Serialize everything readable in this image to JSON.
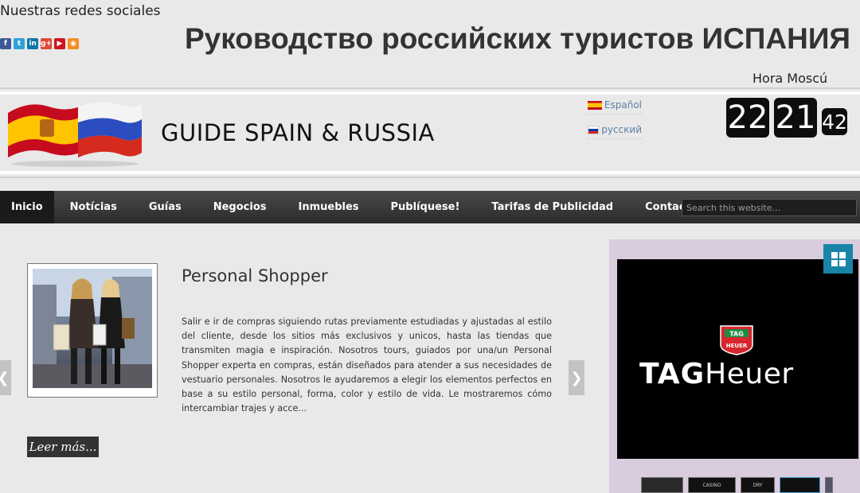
{
  "header": {
    "social_label": "Nuestras redes sociales",
    "site_title": "Руководство российских туристов ИСПАНИЯ",
    "moscow_time_label": "Hora Moscú"
  },
  "social_icons": [
    {
      "name": "facebook-icon",
      "glyph": "f",
      "color": "#3b5998"
    },
    {
      "name": "twitter-icon",
      "glyph": "t",
      "color": "#2fa2d8"
    },
    {
      "name": "linkedin-icon",
      "glyph": "in",
      "color": "#0e76a8"
    },
    {
      "name": "googleplus-icon",
      "glyph": "g+",
      "color": "#dd4b39"
    },
    {
      "name": "youtube-icon",
      "glyph": "▶",
      "color": "#cc181e"
    },
    {
      "name": "rss-icon",
      "glyph": "◉",
      "color": "#f58d25"
    }
  ],
  "brand": {
    "name": "GUIDE SPAIN & RUSSIA"
  },
  "languages": {
    "es": "Español",
    "ru": "русский"
  },
  "clock": {
    "hours": "22",
    "minutes": "21",
    "seconds": "42"
  },
  "nav": {
    "items": [
      "Inicio",
      "Notícias",
      "Guías",
      "Negocios",
      "Inmuebles",
      "Publíquese!",
      "Tarifas de Publicidad",
      "Contacto"
    ],
    "active_index": 0,
    "search_placeholder": "Search this website…"
  },
  "article": {
    "title": "Personal Shopper",
    "body": "Salir e ir de compras siguiendo rutas previamente estudiadas y ajustadas al estilo del cliente, desde los sitios más exclusivos y unicos, hasta las tiendas que transmiten magia e inspiración. Nosotros tours, guiados por una/un Personal Shopper experta en compras, están diseñados para atender a sus necesidades de vestuario personales. Nosotros le ayudaremos a elegir los elementos perfectos en base a su estilo personal, forma, color y estilo de vida. Le mostraremos cómo intercambiar trajes y acce...",
    "read_more": "Leer más..."
  },
  "ad": {
    "brand_bold": "TAG",
    "brand_rest": "Heuer",
    "shield_top": "TAG",
    "shield_bottom": "HEUER",
    "thumbs": [
      "",
      "CASINO",
      "DRY",
      ""
    ]
  },
  "colors": {
    "nav_active": "#1a1a1a",
    "link_blue": "#5b7fa6",
    "grid_button": "#1a83a8",
    "sidebar_bg": "#d8ccde"
  }
}
